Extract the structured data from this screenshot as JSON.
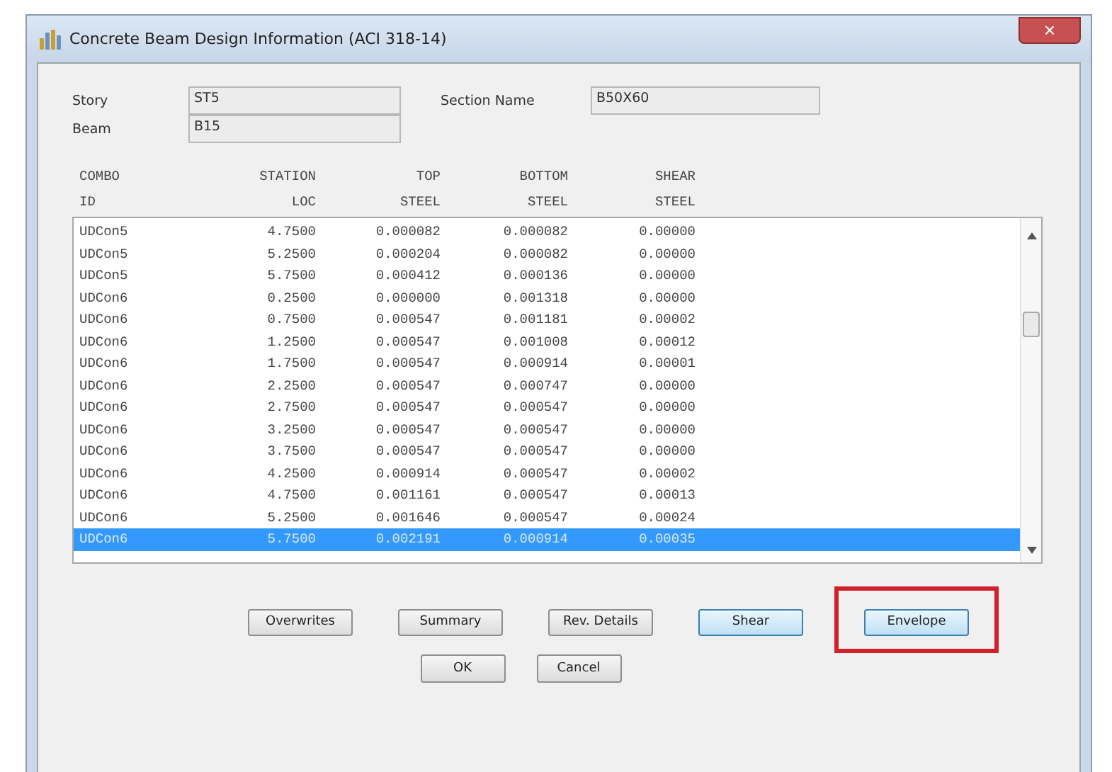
{
  "window": {
    "title": "Concrete Beam Design Information (ACI 318-14)",
    "close": "×"
  },
  "fields": [
    {
      "label": "Story",
      "value": "ST5"
    },
    {
      "label": "Beam",
      "value": "B15"
    },
    {
      "label": "Section Name",
      "value": "B50X60"
    }
  ],
  "table": {
    "columns": [
      {
        "heading": "COMBO",
        "subheading": "ID"
      },
      {
        "heading": "STATION",
        "subheading": "LOC"
      },
      {
        "heading": "TOP",
        "subheading": "STEEL"
      },
      {
        "heading": "BOTTOM",
        "subheading": "STEEL"
      },
      {
        "heading": "SHEAR",
        "subheading": "STEEL"
      }
    ],
    "rows": [
      {
        "cells": [
          "UDCon5",
          "4.7500",
          "0.000082",
          "0.000082",
          "0.00000"
        ],
        "selected": false
      },
      {
        "cells": [
          "UDCon5",
          "5.2500",
          "0.000204",
          "0.000082",
          "0.00000"
        ],
        "selected": false
      },
      {
        "cells": [
          "UDCon5",
          "5.7500",
          "0.000412",
          "0.000136",
          "0.00000"
        ],
        "selected": false
      },
      {
        "cells": [
          "UDCon6",
          "0.2500",
          "0.000000",
          "0.001318",
          "0.00000"
        ],
        "selected": false
      },
      {
        "cells": [
          "UDCon6",
          "0.7500",
          "0.000547",
          "0.001181",
          "0.00002"
        ],
        "selected": false
      },
      {
        "cells": [
          "UDCon6",
          "1.2500",
          "0.000547",
          "0.001008",
          "0.00012"
        ],
        "selected": false
      },
      {
        "cells": [
          "UDCon6",
          "1.7500",
          "0.000547",
          "0.000914",
          "0.00001"
        ],
        "selected": false
      },
      {
        "cells": [
          "UDCon6",
          "2.2500",
          "0.000547",
          "0.000747",
          "0.00000"
        ],
        "selected": false
      },
      {
        "cells": [
          "UDCon6",
          "2.7500",
          "0.000547",
          "0.000547",
          "0.00000"
        ],
        "selected": false
      },
      {
        "cells": [
          "UDCon6",
          "3.2500",
          "0.000547",
          "0.000547",
          "0.00000"
        ],
        "selected": false
      },
      {
        "cells": [
          "UDCon6",
          "3.7500",
          "0.000547",
          "0.000547",
          "0.00000"
        ],
        "selected": false
      },
      {
        "cells": [
          "UDCon6",
          "4.2500",
          "0.000914",
          "0.000547",
          "0.00002"
        ],
        "selected": false
      },
      {
        "cells": [
          "UDCon6",
          "4.7500",
          "0.001161",
          "0.000547",
          "0.00013"
        ],
        "selected": false
      },
      {
        "cells": [
          "UDCon6",
          "5.2500",
          "0.001646",
          "0.000547",
          "0.00024"
        ],
        "selected": false
      },
      {
        "cells": [
          "UDCon6",
          "5.7500",
          "0.002191",
          "0.000914",
          "0.00035"
        ],
        "selected": true
      }
    ]
  },
  "buttons": [
    {
      "label": "Overwrites",
      "highlighted": false,
      "callout": false
    },
    {
      "label": "Summary",
      "highlighted": false,
      "callout": false
    },
    {
      "label": "Rev. Details",
      "highlighted": false,
      "callout": false
    },
    {
      "label": "Shear",
      "highlighted": true,
      "callout": false
    },
    {
      "label": "Envelope",
      "highlighted": true,
      "callout": true
    }
  ],
  "dialog_buttons": [
    "OK",
    "Cancel"
  ]
}
